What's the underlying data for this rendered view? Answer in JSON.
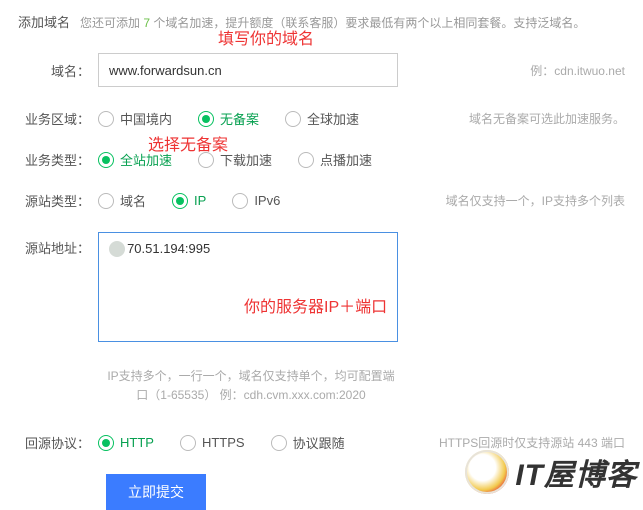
{
  "header": {
    "title": "添加域名",
    "desc_prefix": "您还可添加 ",
    "desc_num": "7",
    "desc_suffix": " 个域名加速，提升额度（联系客服）要求最低有两个以上相同套餐。支持泛域名。"
  },
  "domain": {
    "label": "域名：",
    "value": "www.forwardsun.cn",
    "hint": "例：cdn.itwuo.net",
    "annotation": "填写你的域名"
  },
  "region": {
    "label": "业务区域：",
    "options": [
      "中国境内",
      "无备案",
      "全球加速"
    ],
    "selected": 1,
    "hint": "域名无备案可选此加速服务。",
    "annotation": "选择无备案"
  },
  "biztype": {
    "label": "业务类型：",
    "options": [
      "全站加速",
      "下载加速",
      "点播加速"
    ],
    "selected": 0
  },
  "srctype": {
    "label": "源站类型：",
    "options": [
      "域名",
      "IP",
      "IPv6"
    ],
    "selected": 1,
    "hint": "域名仅支持一个，IP支持多个列表"
  },
  "origin": {
    "label": "源站地址：",
    "value": "     70.51.194:995",
    "annotation": "你的服务器IP＋端口",
    "note": "IP支持多个，一行一个，域名仅支持单个，均可配置端口（1-65535） 例：cdh.cvm.xxx.com:2020"
  },
  "protocol": {
    "label": "回源协议：",
    "options": [
      "HTTP",
      "HTTPS",
      "协议跟随"
    ],
    "selected": 0,
    "hint": "HTTPS回源时仅支持源站 443 端口"
  },
  "submit": {
    "label": "立即提交"
  },
  "watermark": {
    "text": "IT屋博客"
  }
}
